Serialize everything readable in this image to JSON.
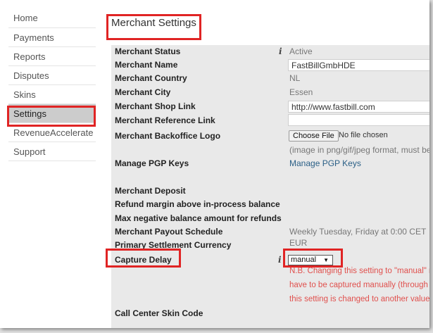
{
  "sidebar": {
    "items": [
      {
        "label": "Home",
        "active": false
      },
      {
        "label": "Payments",
        "active": false
      },
      {
        "label": "Reports",
        "active": false
      },
      {
        "label": "Disputes",
        "active": false
      },
      {
        "label": "Skins",
        "active": false
      },
      {
        "label": "Settings",
        "active": true
      },
      {
        "label": "RevenueAccelerate",
        "active": false
      },
      {
        "label": "Support",
        "active": false
      }
    ]
  },
  "page": {
    "title": "Merchant Settings"
  },
  "fields": {
    "merchant_status": {
      "label": "Merchant Status",
      "value": "Active",
      "info_icon": "info-icon"
    },
    "merchant_name": {
      "label": "Merchant Name",
      "value": "FastBillGmbHDE"
    },
    "merchant_country": {
      "label": "Merchant Country",
      "value": "NL"
    },
    "merchant_city": {
      "label": "Merchant City",
      "value": "Essen"
    },
    "merchant_shop_link": {
      "label": "Merchant Shop Link",
      "value": "http://www.fastbill.com"
    },
    "merchant_reference_link": {
      "label": "Merchant Reference Link",
      "value": ""
    },
    "backoffice_logo": {
      "label": "Merchant Backoffice Logo",
      "button": "Choose File",
      "file_status": "No file chosen",
      "hint": "(image in png/gif/jpeg format, must be"
    },
    "pgp_keys": {
      "label": "Manage PGP Keys",
      "link": "Manage PGP Keys"
    },
    "merchant_deposit": {
      "label": "Merchant Deposit"
    },
    "refund_margin": {
      "label": "Refund margin above in-process balance"
    },
    "max_negative_balance": {
      "label": "Max negative balance amount for refunds"
    },
    "payout_schedule": {
      "label": "Merchant Payout Schedule",
      "value": "Weekly Tuesday, Friday at 0:00 CET"
    },
    "settlement_currency": {
      "label": "Primary Settlement Currency",
      "value": "EUR"
    },
    "capture_delay": {
      "label": "Capture Delay",
      "selected": "manual",
      "info_icon": "info-icon",
      "note_lines": [
        "N.B. Changing this setting to \"manual\" r",
        "have to be captured manually (through",
        "this setting is changed to another value"
      ]
    },
    "call_center_skin_code": {
      "label": "Call Center Skin Code"
    }
  },
  "colors": {
    "highlight_red": "#e02424",
    "panel_bg": "#e9e9e9",
    "active_nav_bg": "#cccccc",
    "link": "#2a5f86",
    "warning_text": "#e0504d"
  }
}
